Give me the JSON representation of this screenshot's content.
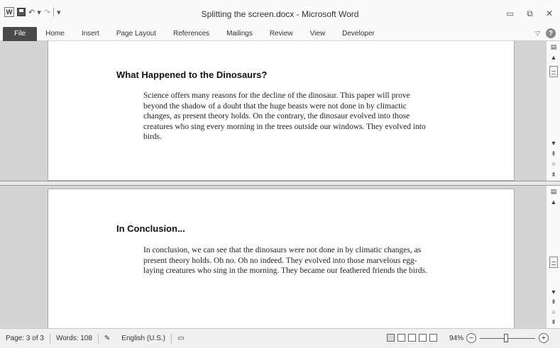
{
  "window": {
    "title": "Splitting the screen.docx - Microsoft Word",
    "app_icon": "W",
    "controls": {
      "minimize": "▭",
      "restore": "⧉",
      "close": "✕"
    }
  },
  "ribbon": {
    "tabs": [
      "File",
      "Home",
      "Insert",
      "Page Layout",
      "References",
      "Mailings",
      "Review",
      "View",
      "Developer"
    ],
    "help": "?"
  },
  "document": {
    "top_pane": {
      "heading": "What Happened to the Dinosaurs?",
      "body": "Science offers many reasons for the decline of the dinosaur. This paper will prove beyond the shadow of a doubt that the huge beasts were not done in by climactic changes, as present theory holds. On the contrary, the dinosaur evolved into those creatures who sing every morning in the trees outside our windows. They evolved into birds."
    },
    "bottom_pane": {
      "heading": "In Conclusion...",
      "body": "In conclusion, we can see that the dinosaurs were not done in by climatic changes, as present theory holds. Oh no. Oh no indeed. They evolved into those marvelous egg-laying creatures who sing in the morning. They became our feathered friends the birds."
    }
  },
  "status": {
    "page": "Page: 3 of 3",
    "words": "Words: 108",
    "language": "English (U.S.)",
    "zoom": "94%",
    "zoom_level_percent": 94
  },
  "icons": [
    "word-app-icon",
    "save-icon",
    "undo-icon",
    "redo-icon",
    "customize-qat-icon",
    "minimize-icon",
    "restore-icon",
    "close-icon",
    "minimize-ribbon-icon",
    "help-icon",
    "ruler-icon",
    "scroll-up-icon",
    "scroll-down-icon",
    "prev-page-icon",
    "browse-object-icon",
    "next-page-icon",
    "proofing-icon",
    "macro-icon"
  ]
}
